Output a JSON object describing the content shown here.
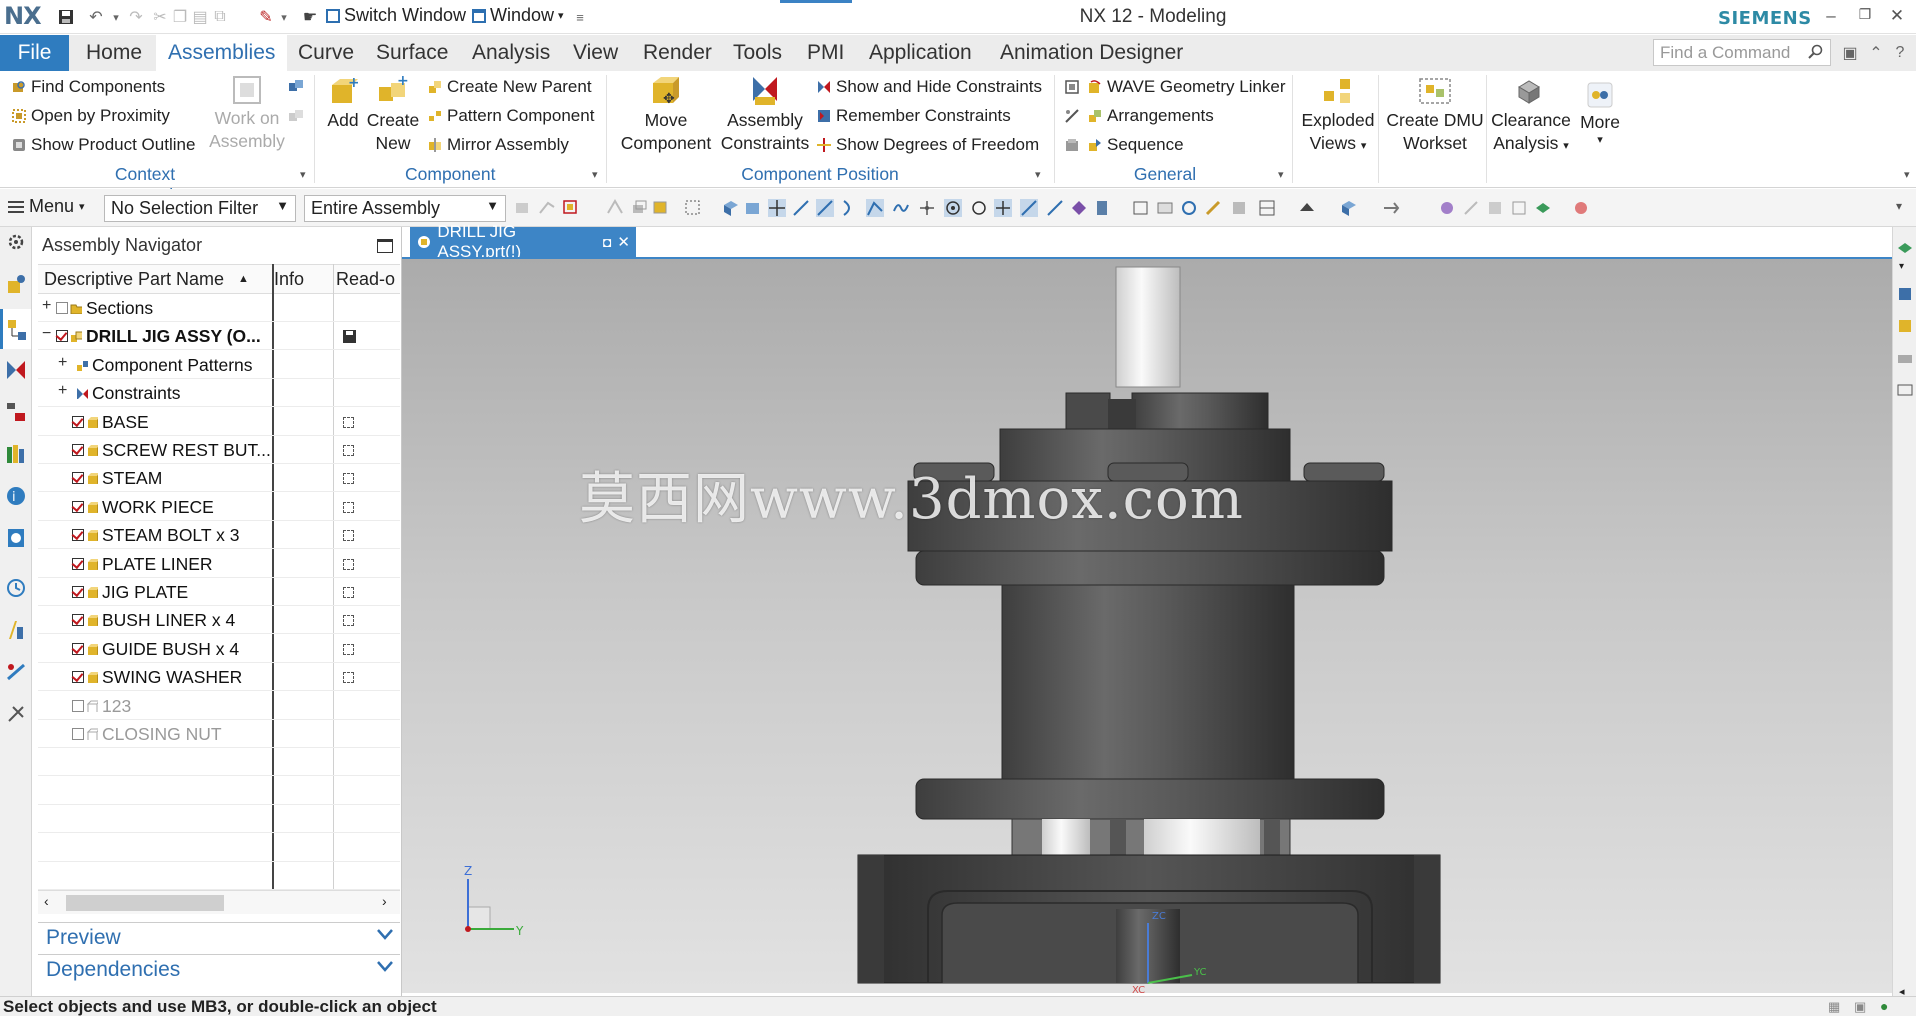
{
  "titlebar": {
    "logo": "NX",
    "switch_window": "Switch Window",
    "window": "Window",
    "app_title": "NX 12 - Modeling",
    "brand": "SIEMENS"
  },
  "menubar": {
    "tabs": [
      "File",
      "Home",
      "Assemblies",
      "Curve",
      "Surface",
      "Analysis",
      "View",
      "Render",
      "Tools",
      "PMI",
      "Application",
      "Animation Designer"
    ],
    "active_tab": "Assemblies",
    "find_command_placeholder": "Find a Command"
  },
  "ribbon": {
    "context_control": {
      "group": "Context Control",
      "items": [
        "Find Components",
        "Open by Proximity",
        "Show Product Outline"
      ],
      "work_on_assembly": [
        "Work on",
        "Assembly"
      ]
    },
    "component": {
      "group": "Component",
      "add": "Add",
      "create_new": [
        "Create",
        "New"
      ],
      "items": [
        "Create New Parent",
        "Pattern Component",
        "Mirror Assembly"
      ]
    },
    "component_position": {
      "group": "Component Position",
      "move_component": [
        "Move",
        "Component"
      ],
      "assembly_constraints": [
        "Assembly",
        "Constraints"
      ],
      "items": [
        "Show and Hide Constraints",
        "Remember Constraints",
        "Show Degrees of Freedom"
      ]
    },
    "general": {
      "group": "General",
      "items": [
        "WAVE Geometry Linker",
        "Arrangements",
        "Sequence"
      ]
    },
    "exploded_views": [
      "Exploded",
      "Views"
    ],
    "create_dmu": [
      "Create DMU",
      "Workset"
    ],
    "clearance": [
      "Clearance",
      "Analysis"
    ],
    "more": "More"
  },
  "toolbar": {
    "menu": "Menu",
    "selection_filter": "No Selection Filter",
    "scope": "Entire Assembly"
  },
  "navigator": {
    "title": "Assembly Navigator",
    "columns": [
      "Descriptive Part Name",
      "Info",
      "Read-o"
    ],
    "rows": [
      {
        "name": "Sections",
        "level": 0,
        "expander": "+",
        "check": "off",
        "icon": "folder"
      },
      {
        "name": "DRILL JIG ASSY (O...",
        "level": 0,
        "expander": "−",
        "check": "on",
        "icon": "assembly",
        "bold": true,
        "readonly": "save"
      },
      {
        "name": "Component Patterns",
        "level": 1,
        "expander": "+",
        "check": "none",
        "icon": "pattern"
      },
      {
        "name": "Constraints",
        "level": 1,
        "expander": "+",
        "check": "none",
        "icon": "constraint"
      },
      {
        "name": "BASE",
        "level": 1,
        "check": "on",
        "icon": "part",
        "readonly": "box"
      },
      {
        "name": "SCREW REST BUT...",
        "level": 1,
        "check": "on",
        "icon": "part",
        "readonly": "box"
      },
      {
        "name": "STEAM",
        "level": 1,
        "check": "on",
        "icon": "part",
        "readonly": "box"
      },
      {
        "name": "WORK PIECE",
        "level": 1,
        "check": "on",
        "icon": "part",
        "readonly": "box"
      },
      {
        "name": "STEAM BOLT x 3",
        "level": 1,
        "check": "on",
        "icon": "part",
        "readonly": "box"
      },
      {
        "name": "PLATE LINER",
        "level": 1,
        "check": "on",
        "icon": "part",
        "readonly": "box"
      },
      {
        "name": "JIG PLATE",
        "level": 1,
        "check": "on",
        "icon": "part",
        "readonly": "box"
      },
      {
        "name": "BUSH LINER x 4",
        "level": 1,
        "check": "on",
        "icon": "part",
        "readonly": "box"
      },
      {
        "name": "GUIDE BUSH x 4",
        "level": 1,
        "check": "on",
        "icon": "part",
        "readonly": "box"
      },
      {
        "name": "SWING WASHER",
        "level": 1,
        "check": "on",
        "icon": "part",
        "readonly": "box"
      },
      {
        "name": "123",
        "level": 1,
        "check": "off",
        "icon": "part-grey",
        "grey": true
      },
      {
        "name": "CLOSING NUT",
        "level": 1,
        "check": "off",
        "icon": "part-grey",
        "grey": true
      }
    ],
    "panels": [
      "Preview",
      "Dependencies"
    ]
  },
  "graphics": {
    "tab_label": "DRILL JIG ASSY.prt(!)",
    "watermark": "莫西网www.3dmox.com",
    "triad": {
      "z": "Z",
      "y": "Y"
    },
    "wcs": {
      "zc": "ZC",
      "yc": "YC",
      "xc": "XC"
    }
  },
  "status": {
    "text": "Select objects and use MB3, or double-click an object"
  },
  "colors": {
    "accent": "#2f7cbf",
    "tab_active": "#3d85c6",
    "checkbox_red": "#c0181e",
    "part_icon": "#e0b42a"
  }
}
